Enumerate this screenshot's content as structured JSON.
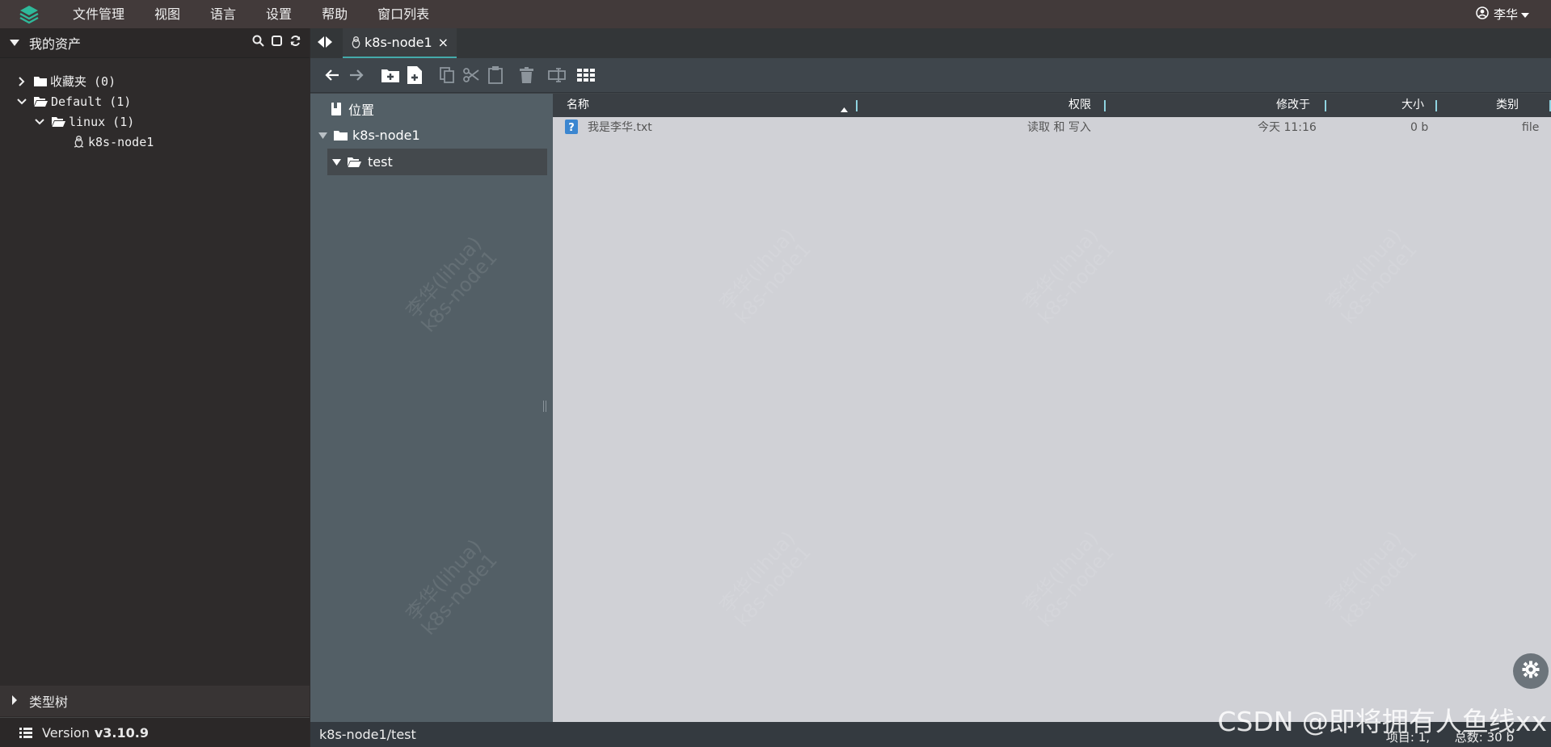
{
  "menubar": {
    "items": [
      "文件管理",
      "视图",
      "语言",
      "设置",
      "帮助",
      "窗口列表"
    ],
    "user": "李华"
  },
  "sidebar": {
    "assets_title": "我的资产",
    "tree": [
      {
        "label": "收藏夹 (0)",
        "expanded": false,
        "level": 0
      },
      {
        "label": "Default (1)",
        "expanded": true,
        "level": 0
      },
      {
        "label": "linux (1)",
        "expanded": true,
        "level": 1
      },
      {
        "label": "k8s-node1",
        "level": 2,
        "icon": "linux-penguin-icon"
      }
    ],
    "types_title": "类型树",
    "version_label": "Version",
    "version_value": "v3.10.9"
  },
  "tab": {
    "title": "k8s-node1",
    "close": "×"
  },
  "locations": {
    "header": "位置",
    "host": "k8s-node1",
    "folder": "test"
  },
  "file_table": {
    "columns": [
      "名称",
      "权限",
      "修改于",
      "大小",
      "类别"
    ],
    "rows": [
      {
        "name": "我是李华.txt",
        "permission": "读取 和 写入",
        "modified": "今天 11:16",
        "size": "0 b",
        "type": "file"
      }
    ]
  },
  "watermark": "李华(lihua)\nk8s-node1",
  "statusbar": {
    "path": "k8s-node1/test",
    "items": "项目: 1,",
    "total": "总数: 30 b"
  },
  "overlay_mark": "CSDN @即将拥有人鱼线xx",
  "colors": {
    "menubar": "#423a3a",
    "sidebar": "#2e2b2b",
    "locations": "#535f66",
    "file_pane": "#d0d1d6",
    "accent": "#4aa",
    "logo": "#2fb99a"
  }
}
